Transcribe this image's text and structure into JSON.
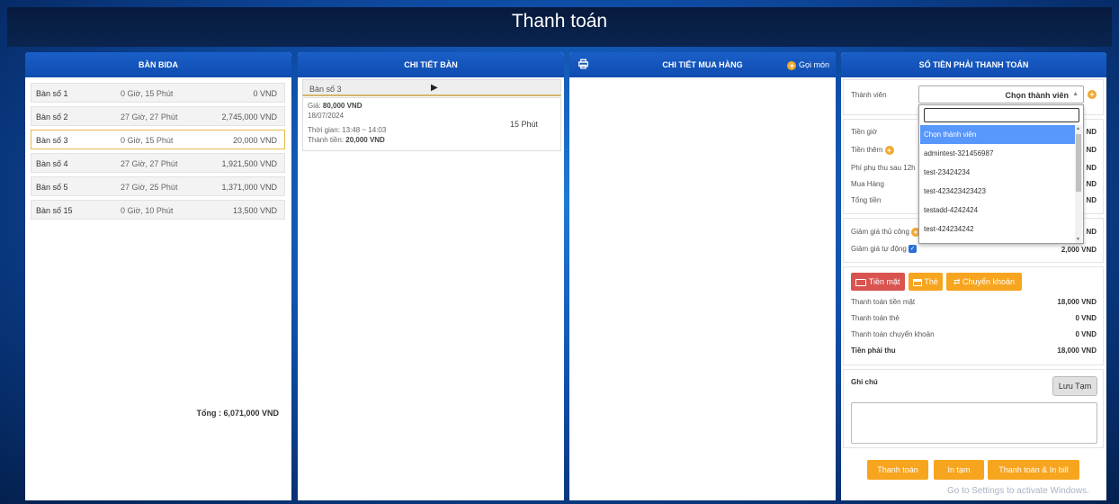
{
  "page": {
    "title": "Thanh toán"
  },
  "panels": {
    "tables": "BÀN BIDA",
    "detail": "CHI TIẾT BÀN",
    "purchases": "CHI TIẾT MUA HÀNG",
    "payment": "SỐ TIỀN PHẢI THANH TOÁN"
  },
  "order_button": "Gọi món",
  "tables": [
    {
      "name": "Bàn số 1",
      "time": "0 Giờ, 15 Phút",
      "price": "0 VND"
    },
    {
      "name": "Bàn số 2",
      "time": "27 Giờ, 27 Phút",
      "price": "2,745,000 VND"
    },
    {
      "name": "Bàn số 3",
      "time": "0 Giờ, 15 Phút",
      "price": "20,000 VND"
    },
    {
      "name": "Bàn số 4",
      "time": "27 Giờ, 27 Phút",
      "price": "1,921,500 VND"
    },
    {
      "name": "Bàn số 5",
      "time": "27 Giờ, 25 Phút",
      "price": "1,371,000 VND"
    },
    {
      "name": "Bàn số 15",
      "time": "0 Giờ, 10 Phút",
      "price": "13,500 VND"
    }
  ],
  "selected_table_index": 2,
  "total_label": "Tổng : 6,071,000 VND",
  "detail": {
    "name": "Bàn số 3",
    "price_label": "Giá: ",
    "price_value": "80,000 VND",
    "date": "18/07/2024",
    "time_label": "Thời gian: 13:48 ~ 14:03",
    "amount_label": "Thành tiền: ",
    "amount_value": "20,000 VND",
    "duration": "15 Phút"
  },
  "payment": {
    "member_label": "Thành viên",
    "member_selected": "Chọn thành viên",
    "dropdown_options": [
      "Chọn thành viên",
      "admintest-321456987",
      "test-23424234",
      "test-423423423423",
      "testadd-4242424",
      "test-424234242"
    ],
    "rows": {
      "hours": "Tiền giờ",
      "extra": "Tiền thêm",
      "surcharge": "Phí phụ thu sau 12h",
      "purchase": "Mua Hàng",
      "total": "Tổng tiền"
    },
    "row_suffix": "ND",
    "manual_discount": "Giảm giá thủ công",
    "auto_discount": "Giảm giá tự động",
    "auto_discount_value": "2,000 VND",
    "methods": {
      "cash": "Tiền mặt",
      "card": "Thẻ",
      "transfer": "Chuyển khoản"
    },
    "summary": [
      {
        "label": "Thanh toán tiền mặt",
        "value": "18,000 VND"
      },
      {
        "label": "Thanh toán thẻ",
        "value": "0 VND"
      },
      {
        "label": "Thanh toán chuyển khoản",
        "value": "0 VND"
      },
      {
        "label": "Tiền phải thu",
        "value": "18,000 VND"
      }
    ],
    "note_label": "Ghi chú",
    "save_temp": "Lưu Tạm",
    "actions": {
      "pay": "Thanh toán",
      "print_temp": "In tạm",
      "pay_print": "Thanh toán & In bill"
    }
  },
  "os_watermark": "Go to Settings to activate Windows.",
  "colors": {
    "header_blue": "#0f4cb0",
    "accent_orange": "#f7a51f",
    "cash_red": "#d9534f",
    "highlight": "#5897fb"
  }
}
